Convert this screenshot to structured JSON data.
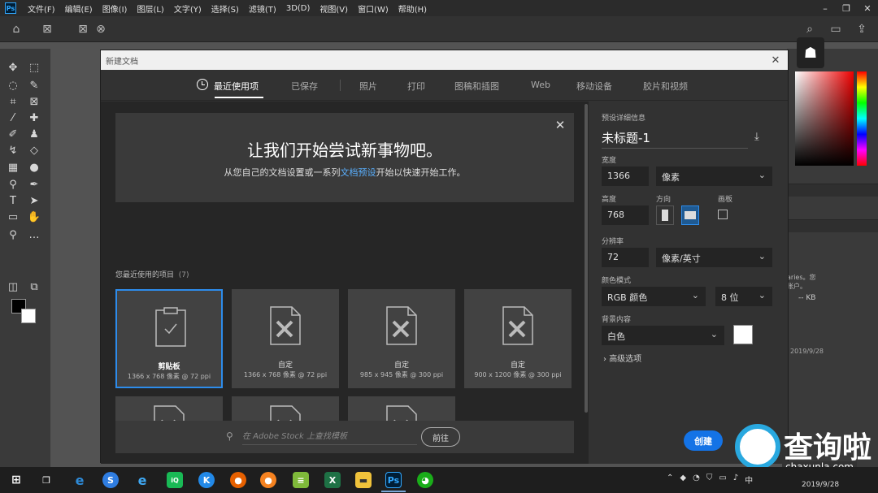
{
  "menubar": {
    "app_icon": "Ps",
    "items": [
      "文件(F)",
      "编辑(E)",
      "图像(I)",
      "图层(L)",
      "文字(Y)",
      "选择(S)",
      "滤镜(T)",
      "3D(D)",
      "视图(V)",
      "窗口(W)",
      "帮助(H)"
    ]
  },
  "dialog": {
    "title": "新建文档",
    "tabs": [
      "最近使用项",
      "已保存",
      "照片",
      "打印",
      "图稿和插图",
      "Web",
      "移动设备",
      "胶片和视频"
    ],
    "welcome_title": "让我们开始尝试新事物吧。",
    "welcome_sub_before": "从您自己的文档设置或一系列",
    "welcome_link": "文档预设",
    "welcome_sub_after": "开始以快速开始工作。",
    "recent_label": "您最近使用的项目",
    "recent_count": "(7)",
    "cards": [
      {
        "name": "剪贴板",
        "size": "1366 x 768 像素 @ 72 ppi"
      },
      {
        "name": "自定",
        "size": "1366 x 768 像素 @ 72 ppi"
      },
      {
        "name": "自定",
        "size": "985 x 945 像素 @ 300 ppi"
      },
      {
        "name": "自定",
        "size": "900 x 1200 像素 @ 300 ppi"
      }
    ],
    "stock_placeholder": "在 Adobe Stock 上查找模板",
    "stock_go": "前往",
    "details": {
      "section_label": "预设详细信息",
      "doc_name": "未标题-1",
      "width_label": "宽度",
      "width_value": "1366",
      "width_unit": "像素",
      "height_label": "高度",
      "height_value": "768",
      "orientation_label": "方向",
      "artboard_label": "画板",
      "resolution_label": "分辨率",
      "resolution_value": "72",
      "resolution_unit": "像素/英寸",
      "color_mode_label": "颜色模式",
      "color_mode": "RGB 颜色",
      "bit_depth": "8 位",
      "bg_label": "背景内容",
      "bg_value": "白色",
      "advanced": "高级选项",
      "create": "创建"
    }
  },
  "right_panel": {
    "text_line1": "aries。您",
    "text_line2": "账户。",
    "kb": "-- KB",
    "date": "2019/9/28"
  },
  "watermark": {
    "text": "查询啦",
    "url": "chaxunla.com"
  },
  "taskbar": {
    "ime": "中",
    "date": "2019/9/28"
  },
  "colors": {
    "accent": "#1473e6",
    "selected_border": "#2d8ceb",
    "link": "#5ab0ff",
    "dialog_bg": "#323232",
    "content_bg": "#262626"
  }
}
